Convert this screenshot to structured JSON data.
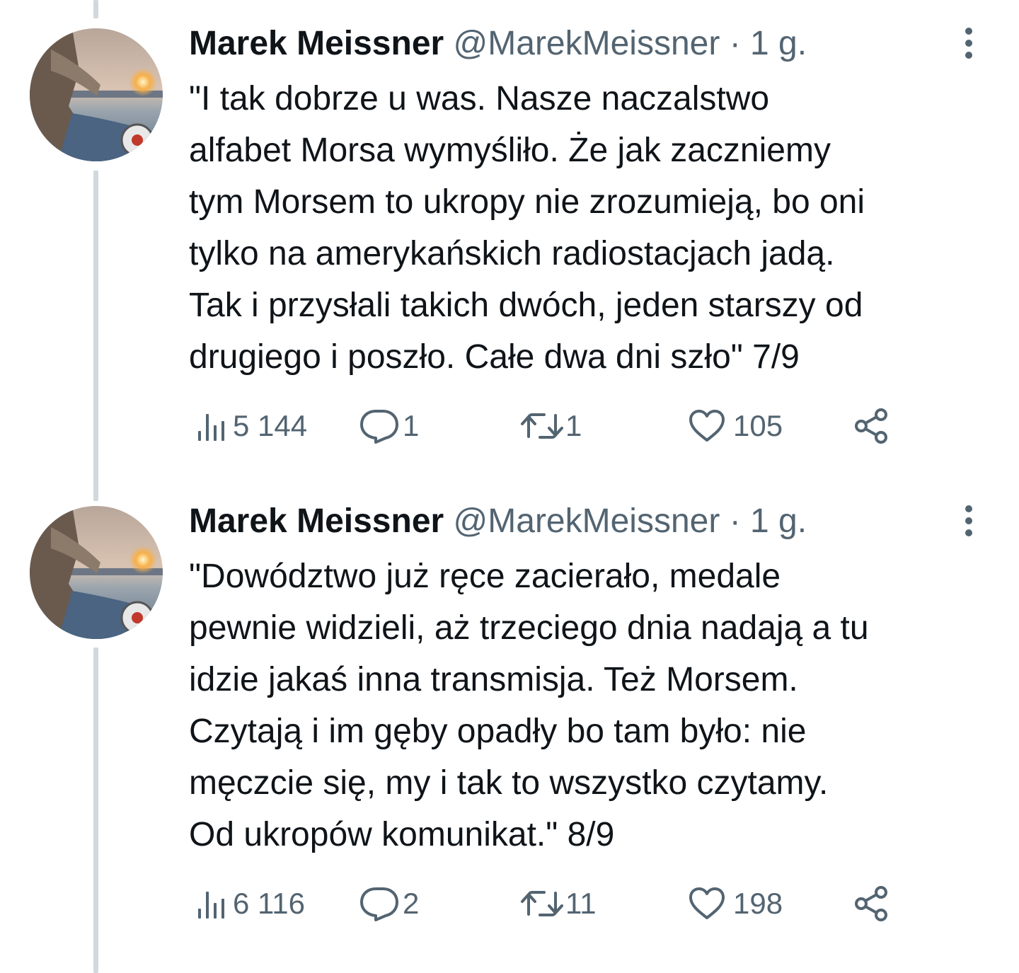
{
  "tweets": [
    {
      "author": "Marek Meissner",
      "handle": "@MarekMeissner",
      "separator": "·",
      "time": "1 g.",
      "text_lines": [
        "\"I tak dobrze u was. Nasze naczalstwo",
        "alfabet Morsa wymyśliło. Że jak zaczniemy",
        "tym Morsem to ukropy nie zrozumieją, bo oni",
        "tylko na amerykańskich radiostacjach jadą.",
        "Tak i przysłali takich dwóch, jeden starszy od",
        "drugiego i poszło. Całe dwa dni szło\" 7/9"
      ],
      "stats": {
        "views": "5 144",
        "replies": "1",
        "retweets": "1",
        "likes": "105"
      }
    },
    {
      "author": "Marek Meissner",
      "handle": "@MarekMeissner",
      "separator": "·",
      "time": "1 g.",
      "text_lines": [
        "\"Dowództwo już ręce zacierało, medale",
        "pewnie widzieli, aż trzeciego dnia nadają a tu",
        "idzie jakaś inna transmisja. Też Morsem.",
        "Czytają i im gęby opadły bo tam było: nie",
        "męczcie się, my i tak to wszystko czytamy.",
        "Od ukropów komunikat.\" 8/9"
      ],
      "stats": {
        "views": "6 116",
        "replies": "2",
        "retweets": "11",
        "likes": "198"
      }
    }
  ],
  "icons": {
    "views": "analytics-icon",
    "reply": "reply-icon",
    "retweet": "retweet-icon",
    "like": "heart-icon",
    "share": "share-icon",
    "more": "more-vertical-icon"
  },
  "colors": {
    "text": "#0f1419",
    "secondary": "#536471",
    "thread_line": "#cfd9de",
    "background": "#ffffff"
  }
}
